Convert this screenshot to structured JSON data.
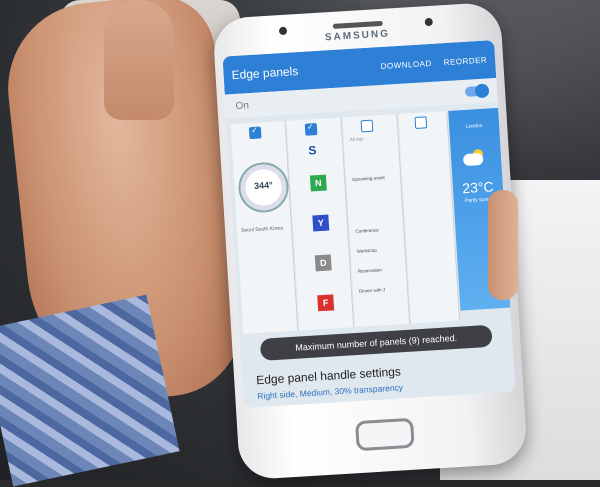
{
  "phone": {
    "brand": "SAMSUNG"
  },
  "app": {
    "title": "Edge panels",
    "actions": [
      "DOWNLOAD",
      "REORDER"
    ],
    "toggle_label": "On"
  },
  "panels": {
    "compass_heading": "344°",
    "location": "Seoul\nSouth Korea",
    "s_letter": "S",
    "tiles": [
      "N",
      "Y",
      "D",
      "F"
    ],
    "calendar_header": "All day",
    "calendar_items": [
      "Upcoming event",
      "Conference",
      "Workshop",
      "Reservation",
      "Dinner with J"
    ],
    "weather_city": "London",
    "weather_temp": "23°C",
    "weather_cond": "Partly sunny"
  },
  "toast": "Maximum number of panels (9) reached.",
  "handle": {
    "title": "Edge panel handle settings",
    "subtitle": "Right side, Medium, 30% transparency"
  },
  "colors": {
    "accent": "#2e7fd6",
    "tile_N": "#2fa84f",
    "tile_Y": "#2f50c8",
    "tile_D": "#8a8a8a",
    "tile_F": "#d8312e"
  }
}
